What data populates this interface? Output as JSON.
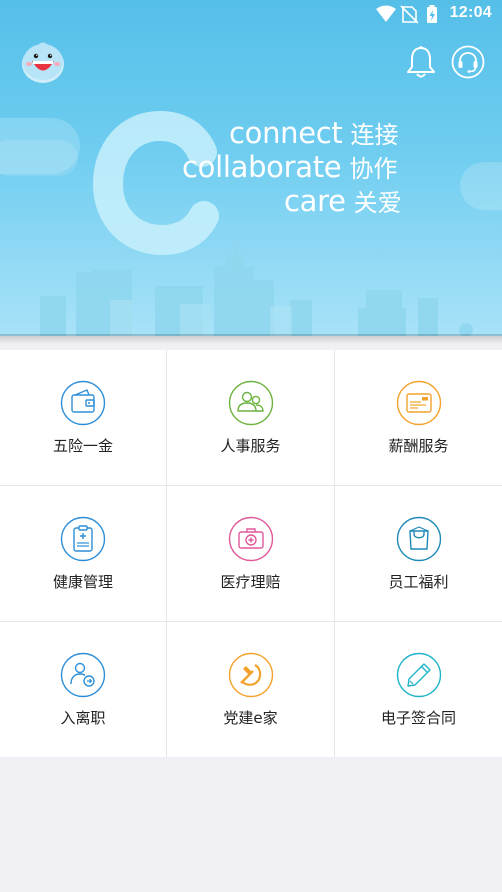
{
  "status_bar": {
    "time": "12:04",
    "icons": [
      "wifi-icon",
      "no-sim-icon",
      "battery-charging-icon"
    ]
  },
  "header": {
    "avatar_icon": "mascot-avatar-icon",
    "notification_icon": "bell-icon",
    "support_icon": "headset-icon"
  },
  "banner": {
    "lines": [
      {
        "en": "connect",
        "cn": "连接"
      },
      {
        "en": "collaborate",
        "cn": "协作"
      },
      {
        "en": "care",
        "cn": "关爱"
      }
    ]
  },
  "services": [
    {
      "label": "五险一金",
      "icon": "wallet-icon",
      "color": "#2e8fd8"
    },
    {
      "label": "人事服务",
      "icon": "people-icon",
      "color": "#6db33f"
    },
    {
      "label": "薪酬服务",
      "icon": "payslip-card-icon",
      "color": "#f2a22c"
    },
    {
      "label": "健康管理",
      "icon": "clipboard-health-icon",
      "color": "#2e8fd8"
    },
    {
      "label": "医疗理赔",
      "icon": "medical-kit-icon",
      "color": "#e0579a"
    },
    {
      "label": "员工福利",
      "icon": "gift-bag-icon",
      "color": "#1f8ab8"
    },
    {
      "label": "入离职",
      "icon": "onboarding-person-icon",
      "color": "#2e8fd8"
    },
    {
      "label": "党建e家",
      "icon": "party-emblem-icon",
      "color": "#f2a22c"
    },
    {
      "label": "电子签合同",
      "icon": "pen-sign-icon",
      "color": "#1fb3c9"
    }
  ]
}
